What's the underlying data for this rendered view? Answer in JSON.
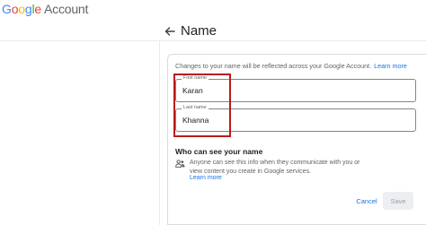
{
  "header": {
    "logo_letters": [
      "G",
      "o",
      "o",
      "g",
      "l",
      "e"
    ],
    "logo_suffix": "Account"
  },
  "page": {
    "title": "Name",
    "back_icon": "arrow-back-icon"
  },
  "notice": {
    "text": "Changes to your name will be reflected across your Google Account.",
    "link": "Learn more"
  },
  "fields": {
    "first_name": {
      "label": "First name",
      "value": "Karan"
    },
    "last_name": {
      "label": "Last name",
      "value": "Khanna"
    }
  },
  "visibility": {
    "title": "Who can see your name",
    "icon": "people-icon",
    "text": "Anyone can see this info when they communicate with you or view content you create in Google services.",
    "link": "Learn more"
  },
  "actions": {
    "cancel_label": "Cancel",
    "save_label": "Save"
  },
  "colors": {
    "accent": "#1a73e8",
    "highlight": "#b91c1c"
  }
}
